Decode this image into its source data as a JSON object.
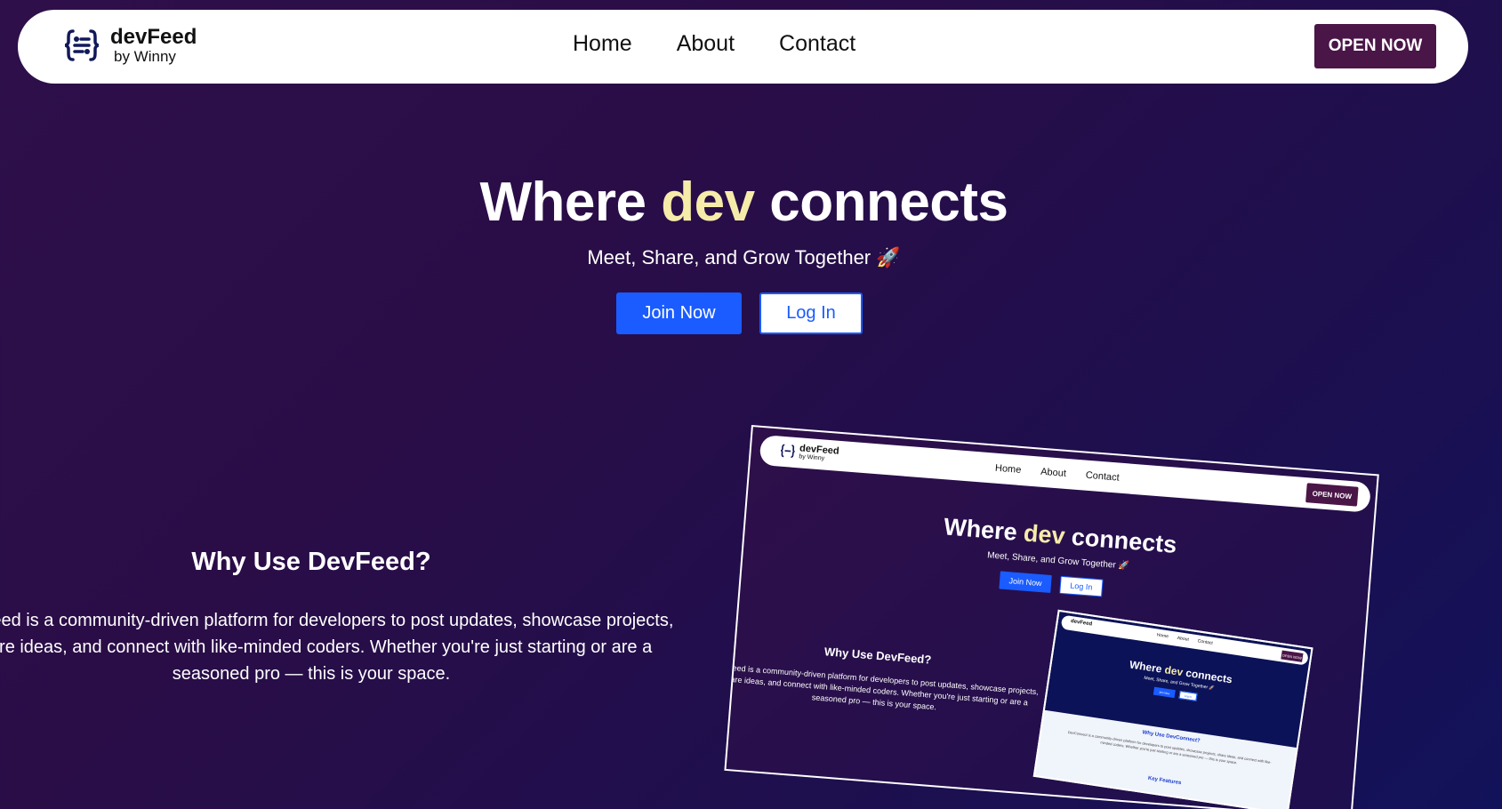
{
  "nav": {
    "brand_name": "devFeed",
    "brand_sub": "by Winny",
    "links": [
      "Home",
      "About",
      "Contact"
    ],
    "cta": "OPEN NOW"
  },
  "hero": {
    "title_before": "Where ",
    "title_highlight": "dev",
    "title_after": " connects",
    "subtitle": "Meet, Share, and Grow Together 🚀",
    "join_label": "Join Now",
    "login_label": "Log In"
  },
  "why": {
    "title": "Why Use DevFeed?",
    "text": "DevFeed is a community-driven platform for developers to post updates, showcase projects, share ideas, and connect with like-minded coders. Whether you're just starting or are a seasoned pro — this is your space."
  },
  "preview": {
    "brand_name": "devFeed",
    "brand_sub": "by Winny",
    "links": [
      "Home",
      "About",
      "Contact"
    ],
    "cta": "OPEN NOW",
    "title_before": "Where ",
    "title_highlight": "dev",
    "title_after": " connects",
    "subtitle": "Meet, Share, and Grow Together 🚀",
    "join_label": "Join Now",
    "login_label": "Log In",
    "why_title": "Why Use DevFeed?",
    "why_text": "DevFeed is a community-driven platform for developers to post updates, showcase projects, share ideas, and connect with like-minded coders. Whether you're just starting or are a seasoned pro — this is your space.",
    "inner": {
      "brand_name": "devFeed",
      "links": [
        "Home",
        "About",
        "Contact"
      ],
      "cta": "OPEN NOW",
      "title_before": "Where ",
      "title_highlight": "dev",
      "title_after": " connects",
      "subtitle": "Meet, Share, and Grow Together 🚀",
      "join_label": "Join Now",
      "login_label": "Log In",
      "why_title": "Why Use DevConnect?",
      "why_text": "DevConnect is a community-driven platform for developers to post updates, showcase projects, share ideas, and connect with like-minded coders. Whether you're just starting or are a seasoned pro — this is your space.",
      "key_title": "Key Features"
    }
  },
  "colors": {
    "accent_button": "#1a5cff",
    "cta_button": "#4a1547",
    "highlight_text": "#f7ebaa",
    "background": "#2a0d47"
  },
  "icons": {
    "brand": "code-braces-chat-icon"
  }
}
